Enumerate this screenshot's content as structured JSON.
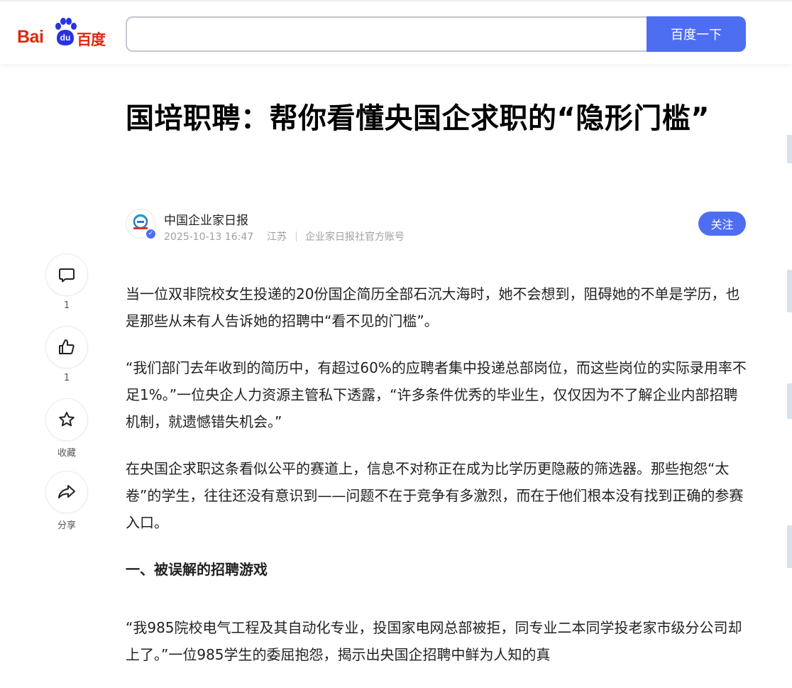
{
  "header": {
    "logo": {
      "text_left": "Bai",
      "text_paw": "du",
      "text_right": "百度",
      "accent": "#de2910",
      "paw_color": "#2932e1"
    },
    "search": {
      "value": "",
      "placeholder": ""
    },
    "search_button_label": "百度一下",
    "accent": "#4e6ef2"
  },
  "article": {
    "title": "国培职聘：帮你看懂央国企求职的“隐形门槛”",
    "author": {
      "name": "中国企业家日报",
      "date": "2025-10-13 16:47",
      "location": "江苏",
      "account_type": "企业家日报社官方账号",
      "verified_icon": "v-badge-icon",
      "follow_label": "关注"
    },
    "paragraphs": [
      "当一位双非院校女生投递的20份国企简历全部石沉大海时，她不会想到，阻碍她的不单是学历，也是那些从未有人告诉她的招聘中“看不见的门槛”。",
      "“我们部门去年收到的简历中，有超过60%的应聘者集中投递总部岗位，而这些岗位的实际录用率不足1%。”一位央企人力资源主管私下透露，“许多条件优秀的毕业生，仅仅因为不了解企业内部招聘机制，就遗憾错失机会。”",
      "在央国企求职这条看似公平的赛道上，信息不对称正在成为比学历更隐蔽的筛选器。那些抱怨“太卷”的学生，往往还没有意识到——问题不在于竞争有多激烈，而在于他们根本没有找到正确的参赛入口。"
    ],
    "section_heading": "一、被误解的招聘游戏",
    "paragraph_after_heading": "“我985院校电气工程及其自动化专业，投国家电网总部被拒，同专业二本同学投老家市级分公司却上了。”一位985学生的委屈抱怨，揭示出央国企招聘中鲜为人知的真"
  },
  "side_actions": [
    {
      "icon": "comment-icon",
      "label": "1"
    },
    {
      "icon": "thumbs-up-icon",
      "label": "1"
    },
    {
      "icon": "star-icon",
      "label": "收藏"
    },
    {
      "icon": "share-icon",
      "label": "分享"
    }
  ]
}
